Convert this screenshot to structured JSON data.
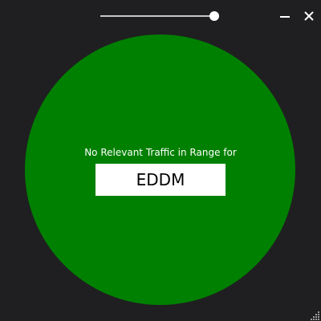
{
  "window": {
    "background_color": "#1f1f21"
  },
  "opacity_slider": {
    "value": 0.97
  },
  "window_controls": {
    "minimize_icon": "minimize-icon",
    "close_icon": "close-icon"
  },
  "status": {
    "circle_color": "#008000",
    "message": "No Relevant Traffic in Range for",
    "airport_code": "EDDM"
  },
  "resize_grip": {
    "icon": "resize-grip-icon"
  }
}
